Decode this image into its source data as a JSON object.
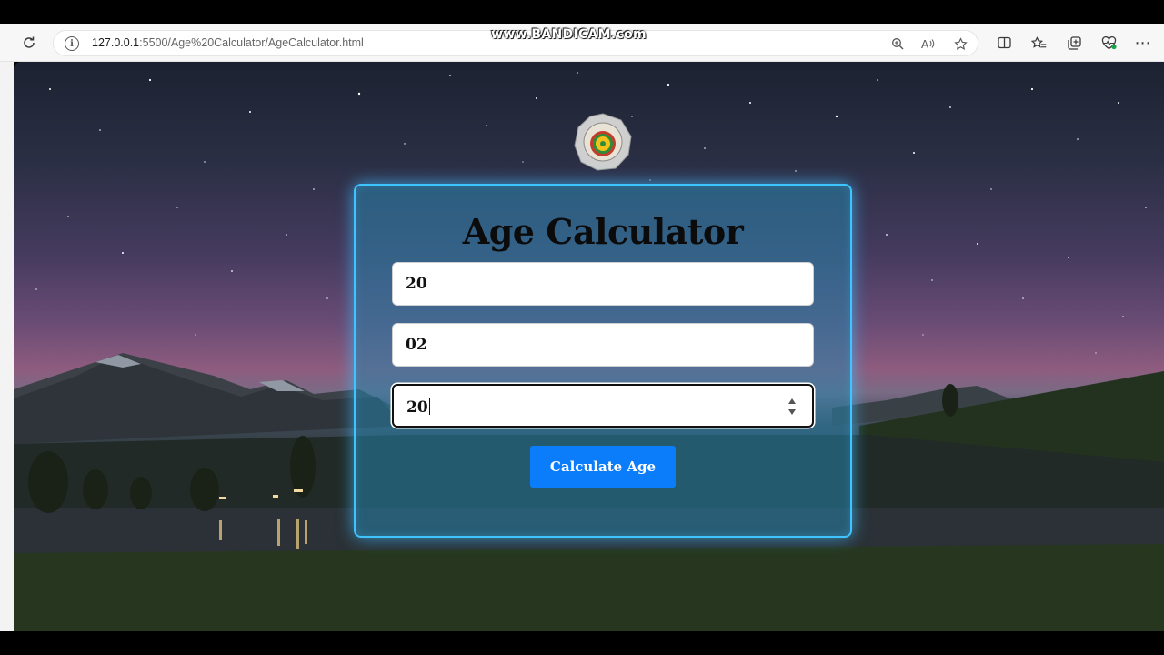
{
  "browser": {
    "url_host": "127.0.0.1",
    "url_rest": ":5500/Age%20Calculator/AgeCalculator.html",
    "icons": {
      "refresh": "refresh-icon",
      "site_info": "info-icon",
      "zoom": "zoom-icon",
      "read_aloud": "read-aloud-icon",
      "favorite": "star-icon",
      "split_screen": "split-screen-icon",
      "favorites": "favorites-list-icon",
      "collections": "collections-icon",
      "browser_essentials": "heart-pulse-icon",
      "more": "more-icon"
    }
  },
  "watermark": "www.BANDICAM.com",
  "app": {
    "title": "Age Calculator",
    "fields": [
      {
        "value": "20"
      },
      {
        "value": "02"
      },
      {
        "value": "20"
      }
    ],
    "button_label": "Calculate Age",
    "accent_color": "#0c7dfa",
    "card_border_color": "#3fc4ff"
  }
}
